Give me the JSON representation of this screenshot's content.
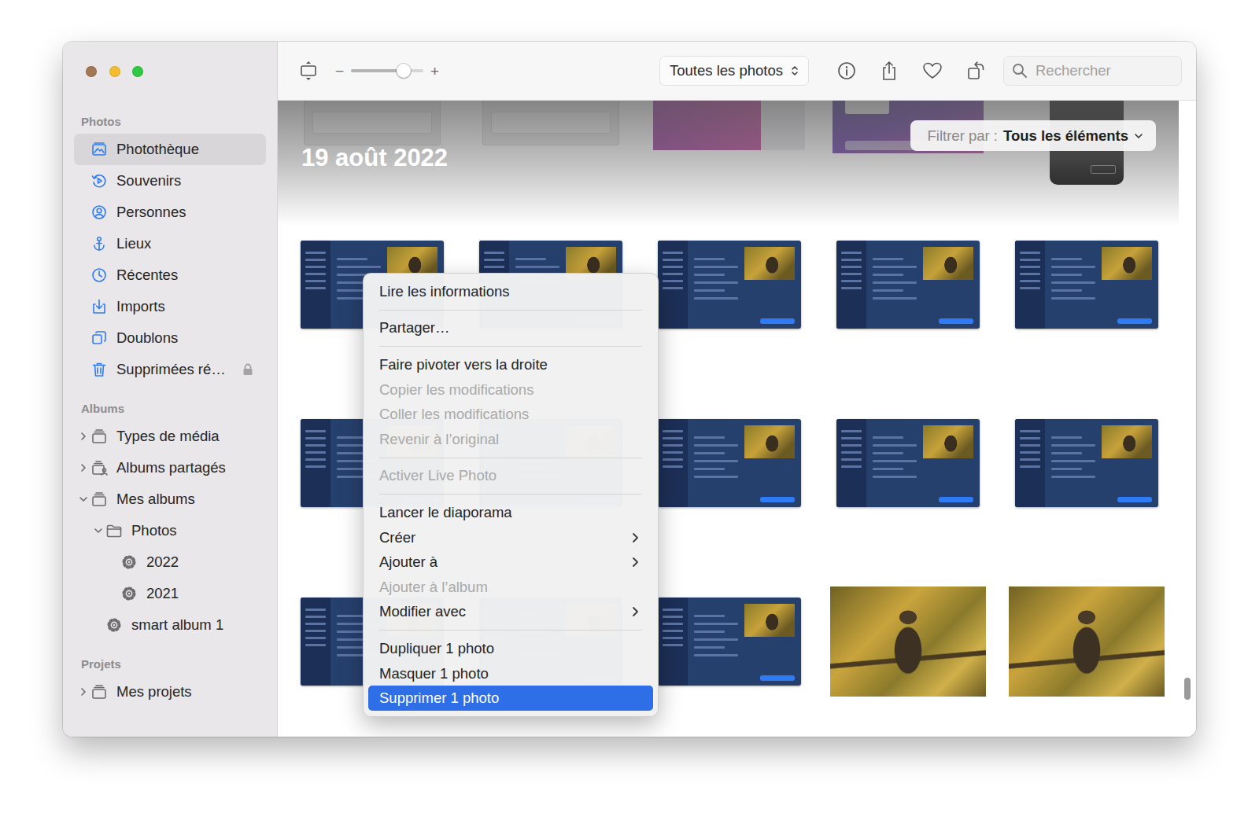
{
  "window": {
    "traffic_lights": [
      {
        "name": "close",
        "color": "#a27752"
      },
      {
        "name": "minimize",
        "color": "#f4bd30"
      },
      {
        "name": "zoom",
        "color": "#30c843"
      }
    ]
  },
  "toolbar": {
    "zoom": {
      "minus": "−",
      "plus": "+",
      "level": 0.73
    },
    "view_menu": "Toutes les photos",
    "search": {
      "placeholder": "Rechercher"
    }
  },
  "sidebar": {
    "sections": [
      {
        "title": "Photos",
        "items": [
          {
            "label": "Photothèque",
            "kind": "library",
            "depth": 0,
            "expandable": false,
            "expanded": false,
            "selected": true,
            "locked": false
          },
          {
            "label": "Souvenirs",
            "kind": "memories",
            "depth": 0,
            "expandable": false,
            "expanded": false,
            "selected": false,
            "locked": false
          },
          {
            "label": "Personnes",
            "kind": "people",
            "depth": 0,
            "expandable": false,
            "expanded": false,
            "selected": false,
            "locked": false
          },
          {
            "label": "Lieux",
            "kind": "places",
            "depth": 0,
            "expandable": false,
            "expanded": false,
            "selected": false,
            "locked": false
          },
          {
            "label": "Récentes",
            "kind": "recent",
            "depth": 0,
            "expandable": false,
            "expanded": false,
            "selected": false,
            "locked": false
          },
          {
            "label": "Imports",
            "kind": "imports",
            "depth": 0,
            "expandable": false,
            "expanded": false,
            "selected": false,
            "locked": false
          },
          {
            "label": "Doublons",
            "kind": "duplicates",
            "depth": 0,
            "expandable": false,
            "expanded": false,
            "selected": false,
            "locked": false
          },
          {
            "label": "Supprimées ré…",
            "kind": "deleted",
            "depth": 0,
            "expandable": false,
            "expanded": false,
            "selected": false,
            "locked": true
          }
        ]
      },
      {
        "title": "Albums",
        "items": [
          {
            "label": "Types de média",
            "kind": "group",
            "depth": 0,
            "expandable": true,
            "expanded": false,
            "selected": false,
            "locked": false
          },
          {
            "label": "Albums partagés",
            "kind": "shared",
            "depth": 0,
            "expandable": true,
            "expanded": false,
            "selected": false,
            "locked": false
          },
          {
            "label": "Mes albums",
            "kind": "group",
            "depth": 0,
            "expandable": true,
            "expanded": true,
            "selected": false,
            "locked": false
          },
          {
            "label": "Photos",
            "kind": "folder",
            "depth": 1,
            "expandable": true,
            "expanded": true,
            "selected": false,
            "locked": false
          },
          {
            "label": "2022",
            "kind": "smart",
            "depth": 2,
            "expandable": false,
            "expanded": false,
            "selected": false,
            "locked": false
          },
          {
            "label": "2021",
            "kind": "smart",
            "depth": 2,
            "expandable": false,
            "expanded": false,
            "selected": false,
            "locked": false
          },
          {
            "label": "smart album 1",
            "kind": "smart",
            "depth": 1,
            "expandable": false,
            "expanded": false,
            "selected": false,
            "locked": false
          }
        ]
      },
      {
        "title": "Projets",
        "items": [
          {
            "label": "Mes projets",
            "kind": "group",
            "depth": 0,
            "expandable": true,
            "expanded": false,
            "selected": false,
            "locked": false
          }
        ]
      }
    ]
  },
  "content": {
    "date": "19 août 2022",
    "filter": {
      "label": "Filtrer par :",
      "value": "Tous les éléments"
    },
    "rows": [
      [
        {
          "kind": "light"
        },
        {
          "kind": "light"
        },
        {
          "kind": "magenta"
        },
        {
          "kind": "desktop"
        },
        {
          "kind": "phone"
        }
      ],
      [
        {
          "kind": "screenshot"
        },
        {
          "kind": "screenshot"
        },
        {
          "kind": "screenshot"
        },
        {
          "kind": "screenshot"
        },
        {
          "kind": "screenshot"
        }
      ],
      [
        {
          "kind": "screenshot"
        },
        {
          "kind": "screenshot"
        },
        {
          "kind": "screenshot"
        },
        {
          "kind": "screenshot"
        },
        {
          "kind": "screenshot"
        }
      ],
      [
        {
          "kind": "screenshot"
        },
        {
          "kind": "screenshot"
        },
        {
          "kind": "screenshot"
        },
        {
          "kind": "photo"
        },
        {
          "kind": "photo"
        }
      ]
    ],
    "scrollbar": {
      "level": 0.94
    }
  },
  "context_menu": {
    "groups": [
      [
        {
          "label": "Lire les informations",
          "disabled": false,
          "submenu": false,
          "selected": false
        }
      ],
      [
        {
          "label": "Partager…",
          "disabled": false,
          "submenu": false,
          "selected": false
        }
      ],
      [
        {
          "label": "Faire pivoter vers la droite",
          "disabled": false,
          "submenu": false,
          "selected": false
        },
        {
          "label": "Copier les modifications",
          "disabled": true,
          "submenu": false,
          "selected": false
        },
        {
          "label": "Coller les modifications",
          "disabled": true,
          "submenu": false,
          "selected": false
        },
        {
          "label": "Revenir à l’original",
          "disabled": true,
          "submenu": false,
          "selected": false
        }
      ],
      [
        {
          "label": "Activer Live Photo",
          "disabled": true,
          "submenu": false,
          "selected": false
        }
      ],
      [
        {
          "label": "Lancer le diaporama",
          "disabled": false,
          "submenu": false,
          "selected": false
        },
        {
          "label": "Créer",
          "disabled": false,
          "submenu": true,
          "selected": false
        },
        {
          "label": "Ajouter à",
          "disabled": false,
          "submenu": true,
          "selected": false
        },
        {
          "label": "Ajouter à l’album",
          "disabled": true,
          "submenu": false,
          "selected": false
        },
        {
          "label": "Modifier avec",
          "disabled": false,
          "submenu": true,
          "selected": false
        }
      ],
      [
        {
          "label": "Dupliquer 1 photo",
          "disabled": false,
          "submenu": false,
          "selected": false
        },
        {
          "label": "Masquer 1 photo",
          "disabled": false,
          "submenu": false,
          "selected": false
        },
        {
          "label": "Supprimer 1 photo",
          "disabled": false,
          "submenu": false,
          "selected": true
        }
      ]
    ]
  }
}
